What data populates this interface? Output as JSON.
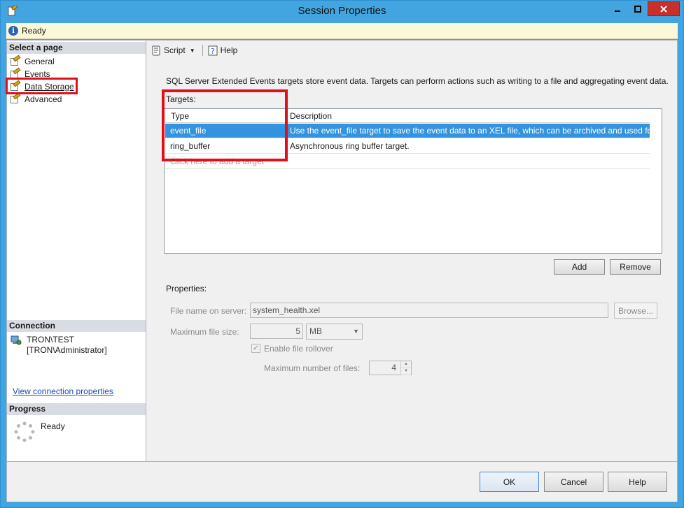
{
  "window": {
    "title": "Session Properties"
  },
  "status": {
    "text": "Ready"
  },
  "left": {
    "select_header": "Select a page",
    "pages": [
      {
        "label": "General"
      },
      {
        "label": "Events"
      },
      {
        "label": "Data Storage"
      },
      {
        "label": "Advanced"
      }
    ],
    "selected_page": "Data Storage",
    "connection_header": "Connection",
    "connection_server": "TRON\\TEST",
    "connection_user": "[TRON\\Administrator]",
    "connection_link": "View connection properties",
    "progress_header": "Progress",
    "progress_text": "Ready"
  },
  "toolbar": {
    "script_label": "Script",
    "help_label": "Help"
  },
  "main": {
    "intro": "SQL Server Extended Events targets store event data. Targets can perform actions such as writing to a file and aggregating event data.",
    "targets_label": "Targets:",
    "columns": {
      "type": "Type",
      "description": "Description"
    },
    "rows": [
      {
        "type": "event_file",
        "description": "Use the event_file target to save the event data to an XEL file, which can be archived and used fo..."
      },
      {
        "type": "ring_buffer",
        "description": "Asynchronous ring buffer target."
      }
    ],
    "add_row_placeholder": "Click here to add a target",
    "add_button": "Add",
    "remove_button": "Remove",
    "properties_label": "Properties:",
    "file_name_label": "File name on server:",
    "file_name_value": "system_health.xel",
    "browse_button": "Browse...",
    "max_file_size_label": "Maximum file size:",
    "max_file_size_value": "5",
    "max_file_size_unit": "MB",
    "rollover_label": "Enable file rollover",
    "max_files_label": "Maximum number of files:",
    "max_files_value": "4"
  },
  "footer": {
    "ok": "OK",
    "cancel": "Cancel",
    "help": "Help"
  },
  "colors": {
    "selection": "#3393df",
    "highlight_box": "#e0101a",
    "titlebar": "#42a5e0"
  }
}
